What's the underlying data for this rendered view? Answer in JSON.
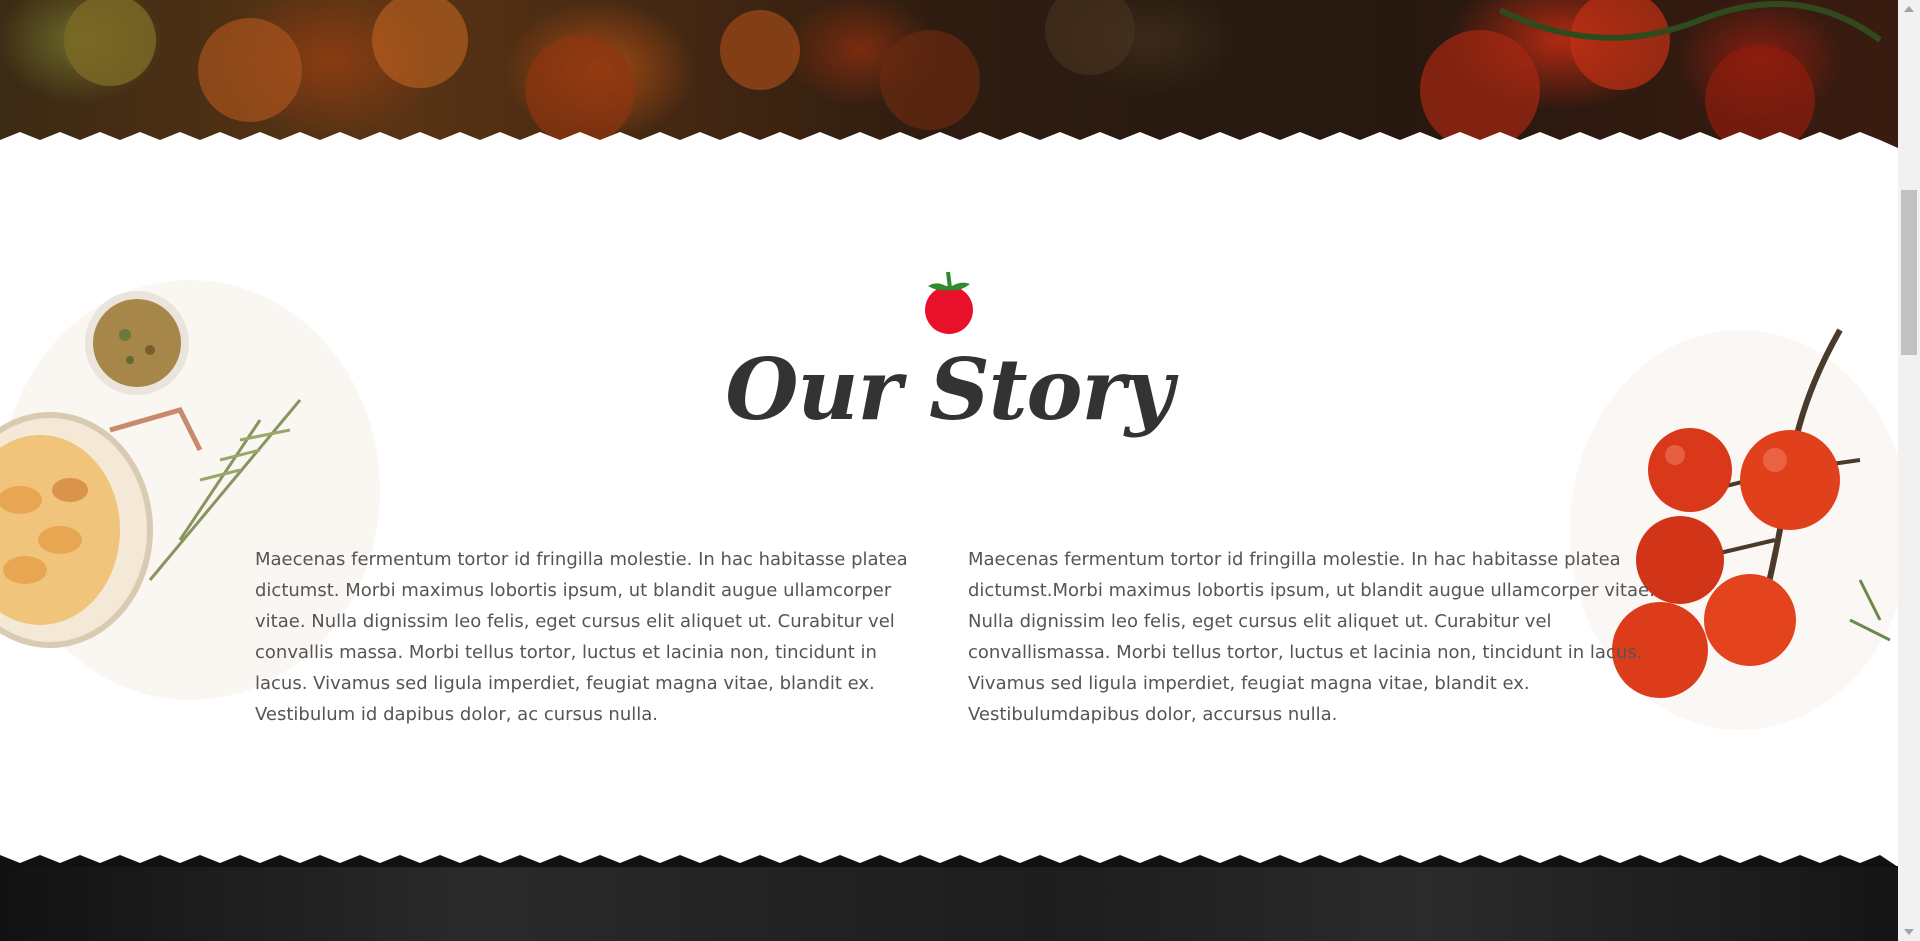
{
  "section": {
    "title": "Our Story",
    "paragraph_left": "Maecenas fermentum tortor id fringilla molestie. In hac habitasse platea dictumst. Morbi maximus lobortis ipsum, ut blandit augue ullamcorper vitae. Nulla dignissim leo felis, eget cursus elit aliquet ut. Curabitur vel convallis massa. Morbi tellus tortor, luctus et lacinia non, tincidunt in lacus. Vivamus sed ligula imperdiet, feugiat magna vitae, blandit ex. Vestibulum id dapibus dolor, ac cursus nulla.",
    "paragraph_right": "Maecenas fermentum tortor id fringilla molestie. In hac habitasse platea dictumst.Morbi maximus lobortis ipsum, ut blandit augue ullamcorper vitae. Nulla dignissim leo felis, eget cursus elit aliquet ut. Curabitur vel convallismassa. Morbi tellus tortor, luctus et lacinia non, tincidunt in lacus. Vivamus sed ligula imperdiet, feugiat magna vitae, blandit ex. Vestibulumdapibus dolor, accursus nulla."
  },
  "icons": {
    "heading_icon": "tomato-icon"
  },
  "colors": {
    "heading": "#333333",
    "body_text": "#555555",
    "tomato_red": "#e8102a",
    "leaf_green": "#2e8b2e",
    "dark_band": "#1a1a1a"
  }
}
